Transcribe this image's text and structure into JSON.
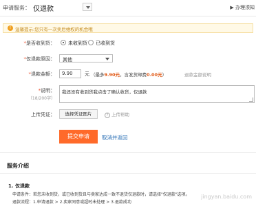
{
  "header": {
    "service_label": "申请服务：",
    "service_value": "仅退款",
    "must_know": "▶ 办理须知"
  },
  "warning": {
    "icon": "!",
    "text": "温馨提示:您只有一次卖后维权的机会哦"
  },
  "form": {
    "received_label": "是否收到货：",
    "received_options": [
      {
        "label": "未收到货",
        "selected": true
      },
      {
        "label": "已收到货",
        "selected": false
      }
    ],
    "reason_label": "仅退款原因：",
    "reason_value": "其他",
    "amount_label": "退款金额：",
    "amount_value": "9.90",
    "amount_unit": "元",
    "amount_hint_prefix": "（最多",
    "amount_hint_max": "9.90元",
    "amount_hint_mid": "，含发货邮费",
    "amount_hint_shipping": "0.00元",
    "amount_hint_suffix": "）",
    "amount_hint2": "退款金额说明",
    "desc_label": "说明：",
    "desc_counter": "（18/200字）",
    "desc_value": "我还没有收到货我点击了确认收货，仅退款",
    "upload_label": "上传凭证：",
    "upload_button": "选择凭证图片",
    "upload_help": "上传帮助",
    "submit_button": "提交申请",
    "cancel_link": "取消并返回"
  },
  "service_intro": {
    "title": "服务介绍",
    "item_title": "1. 仅退款",
    "lines": [
      "申请条件：若您未收到货，或已收到货且与卖家达成一致不退货仅退款时，请选择\"仅退款\"选项。",
      "退款流程：1.申请退款 > 2.卖家同意或超时未处理 > 3.退款成功"
    ],
    "watermark": "jingyan.baidu.com"
  }
}
